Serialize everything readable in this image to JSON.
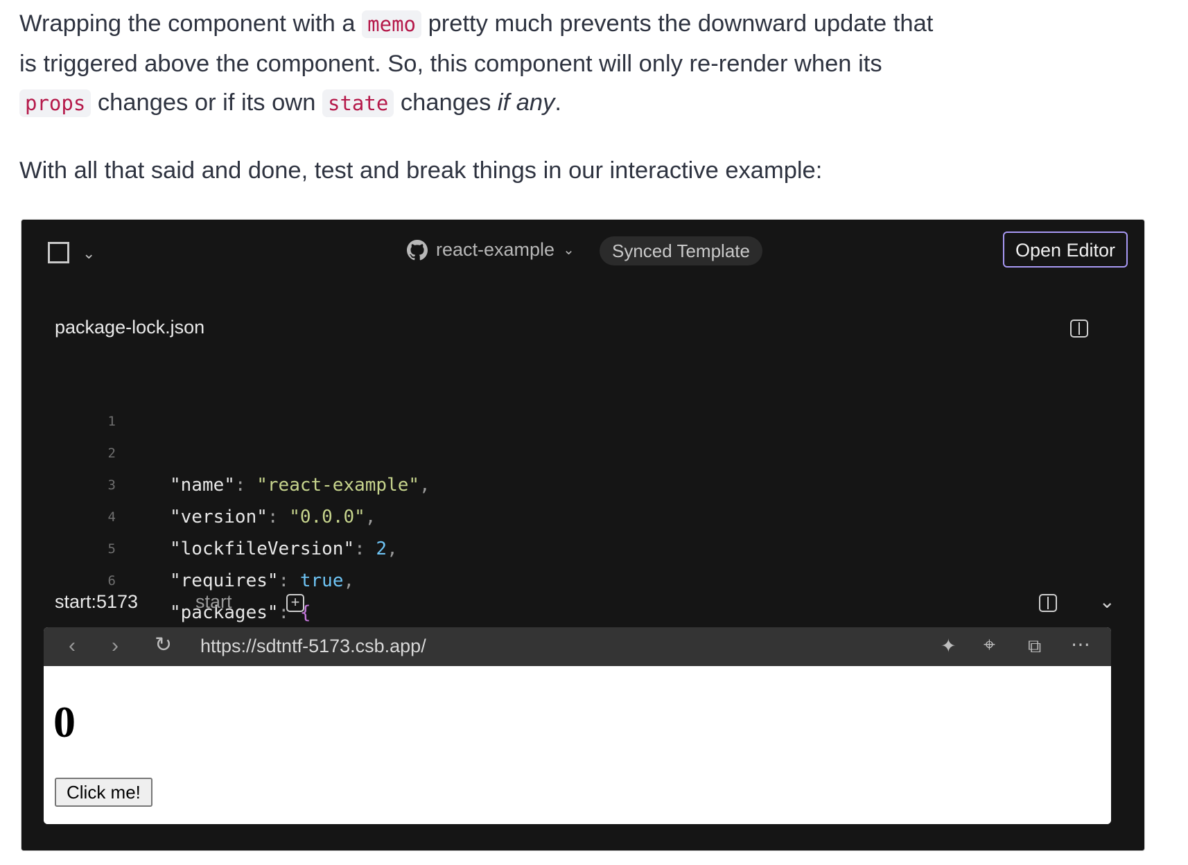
{
  "article": {
    "p1": {
      "t1": "Wrapping the component with a ",
      "c1": "memo",
      "t2": " pretty much prevents the downward update that is triggered above the component. So, this component will only re-render when its ",
      "c2": "props",
      "t3": " changes or if its own ",
      "c3": "state",
      "t4": " changes ",
      "em": "if any",
      "t5": "."
    },
    "p2": "With all that said and done, test and break things in our interactive example:"
  },
  "sandbox": {
    "repo_name": "react-example",
    "badge": "Synced Template",
    "open_editor": "Open Editor",
    "file_tab": "package-lock.json",
    "code_lines": [
      {
        "num": "1"
      },
      {
        "num": "2",
        "key": "\"name\"",
        "sep": ": ",
        "val": "\"react-example\"",
        "end": ","
      },
      {
        "num": "3",
        "key": "\"version\"",
        "sep": ": ",
        "val": "\"0.0.0\"",
        "end": ","
      },
      {
        "num": "4",
        "key": "\"lockfileVersion\"",
        "sep": ": ",
        "val": "2",
        "end": ","
      },
      {
        "num": "5",
        "key": "\"requires\"",
        "sep": ": ",
        "val": "true",
        "end": ","
      },
      {
        "num": "6",
        "key": "\"packages\"",
        "sep": ": ",
        "val": "{",
        "end": ""
      }
    ],
    "terminal_tabs": [
      "start:5173",
      "start"
    ],
    "browser": {
      "url": "https://sdtntf-5173.csb.app/",
      "count": "0",
      "button": "Click me!"
    }
  }
}
